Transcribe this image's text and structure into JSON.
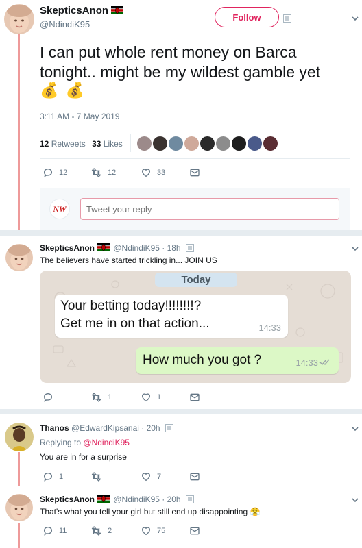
{
  "main_tweet": {
    "display_name": "SkepticsAnon",
    "handle": "@NdindiK95",
    "follow_label": "Follow",
    "text_line1": "I can put whole rent money on Barca",
    "text_line2": "tonight.. might be my wildest gamble yet",
    "emoji": "💰 💰",
    "timestamp": "3:11 AM - 7 May 2019",
    "retweets_count": "12",
    "retweets_label": "Retweets",
    "likes_count": "33",
    "likes_label": "Likes",
    "actions": {
      "reply": "12",
      "retweet": "12",
      "like": "33"
    }
  },
  "reply_box": {
    "placeholder": "Tweet your reply",
    "avatar_text": "NW"
  },
  "reply1": {
    "display_name": "SkepticsAnon",
    "handle_time": "@NdindiK95 · 18h",
    "text": "The believers have started trickling in... JOIN US",
    "chat": {
      "day": "Today",
      "in_line1": "Your betting today!!!!!!!!?",
      "in_line2": "Get me in on that action...",
      "in_time": "14:33",
      "out_text": "How much you got ?",
      "out_time": "14:33"
    },
    "actions": {
      "reply": "",
      "retweet": "1",
      "like": "1"
    }
  },
  "reply2": {
    "display_name": "Thanos",
    "handle_time": "@EdwardKipsanai · 20h",
    "replying_prefix": "Replying to",
    "replying_to": "@NdindiK95",
    "text": "You are in for a surprise",
    "actions": {
      "reply": "1",
      "retweet": "",
      "like": "7"
    }
  },
  "reply3": {
    "display_name": "SkepticsAnon",
    "handle_time": "@NdindiK95 · 20h",
    "text": "That's what you tell your girl but still end up disappointing 😤",
    "actions": {
      "reply": "11",
      "retweet": "2",
      "like": "75"
    }
  },
  "colors": {
    "accent": "#e0245e",
    "thread": "#ee9a9a",
    "muted": "#657786",
    "chat_bg": "#e5ddd5",
    "chat_out": "#dcf8c6"
  }
}
